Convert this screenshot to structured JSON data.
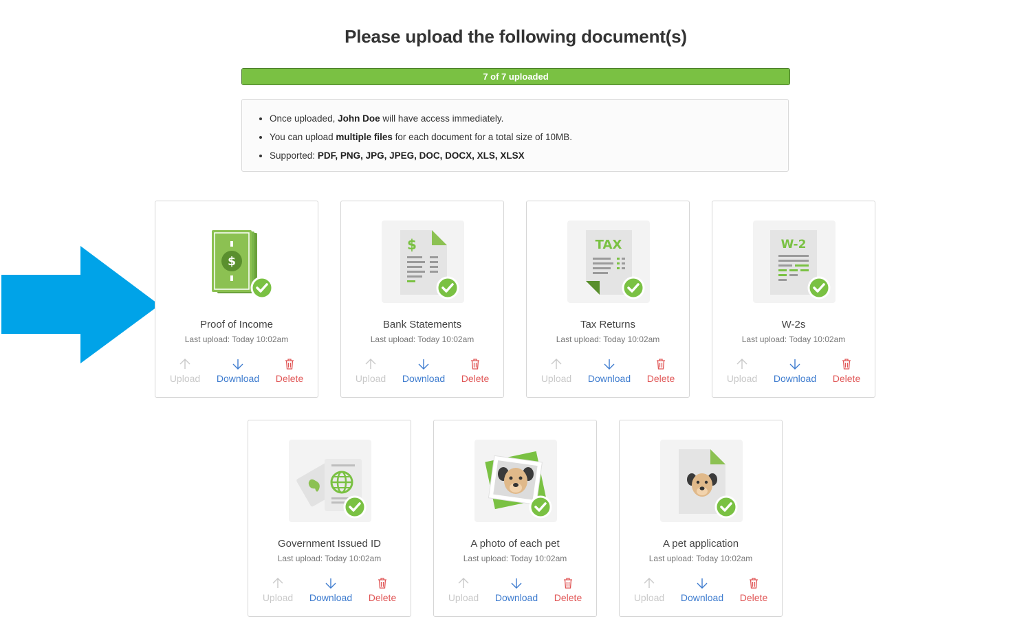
{
  "page": {
    "title": "Please upload the following document(s)"
  },
  "progress": {
    "label": "7 of 7 uploaded",
    "uploaded": 7,
    "total": 7,
    "fill_fraction": 1.0,
    "fill_color": "#7ac143"
  },
  "info": {
    "line1": {
      "pre": "Once uploaded, ",
      "bold": "John Doe",
      "post": " will have access immediately."
    },
    "line2": {
      "pre": "You can upload ",
      "bold": "multiple files",
      "post": " for each document for a total size of 10MB."
    },
    "line3": {
      "pre": "Supported: ",
      "bold": "PDF, PNG, JPG, JPEG, DOC, DOCX, XLS, XLSX"
    }
  },
  "annotation": {
    "icon": "arrow-right-icon",
    "color": "#00a3e8"
  },
  "actions": {
    "upload_label": "Upload",
    "download_label": "Download",
    "delete_label": "Delete"
  },
  "cards": [
    {
      "name": "Proof of Income",
      "last_upload": "Last upload: Today 10:02am",
      "icon": "money-icon"
    },
    {
      "name": "Bank Statements",
      "last_upload": "Last upload: Today 10:02am",
      "icon": "bank-statement-icon"
    },
    {
      "name": "Tax Returns",
      "last_upload": "Last upload: Today 10:02am",
      "icon": "tax-document-icon",
      "icon_text": "TAX"
    },
    {
      "name": "W-2s",
      "last_upload": "Last upload: Today 10:02am",
      "icon": "w2-document-icon",
      "icon_text": "W-2"
    },
    {
      "name": "Government Issued ID",
      "last_upload": "Last upload: Today 10:02am",
      "icon": "passport-icon"
    },
    {
      "name": "A photo of each pet",
      "last_upload": "Last upload: Today 10:02am",
      "icon": "pet-photo-icon"
    },
    {
      "name": "A pet application",
      "last_upload": "Last upload: Today 10:02am",
      "icon": "pet-application-icon"
    }
  ]
}
